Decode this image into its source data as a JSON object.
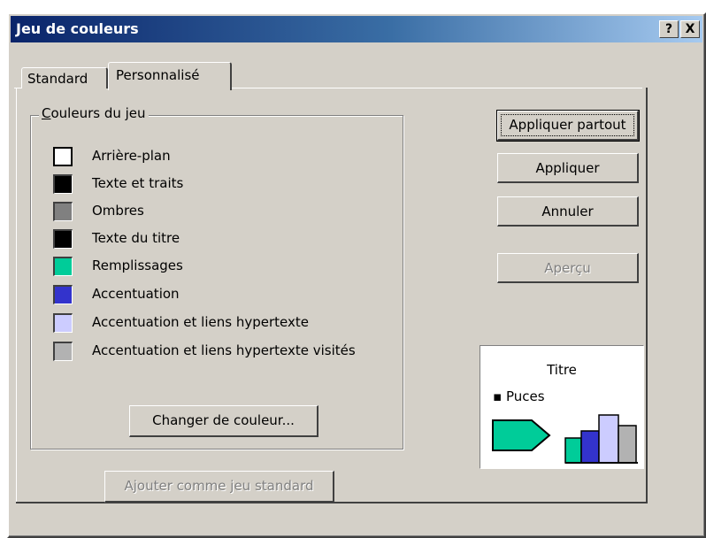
{
  "dialog": {
    "title": "Jeu de couleurs",
    "help_label": "?",
    "close_label": "X"
  },
  "tabs": [
    {
      "label": "Standard",
      "active": false
    },
    {
      "label": "Personnalisé",
      "active": true
    }
  ],
  "group": {
    "legend": "Couleurs du jeu",
    "items": [
      {
        "label": "Arrière-plan",
        "color": "#ffffff",
        "selected": true
      },
      {
        "label": "Texte et traits",
        "color": "#000000"
      },
      {
        "label": "Ombres",
        "color": "#808080"
      },
      {
        "label": "Texte du titre",
        "color": "#000000"
      },
      {
        "label": "Remplissages",
        "color": "#00cc99"
      },
      {
        "label": "Accentuation",
        "color": "#3333cc"
      },
      {
        "label": "Accentuation et liens hypertexte",
        "color": "#ccccff"
      },
      {
        "label": "Accentuation et liens hypertexte visités",
        "color": "#b2b2b2"
      }
    ],
    "change_color_button": "Changer de couleur..."
  },
  "buttons": {
    "apply_all": "Appliquer partout",
    "apply": "Appliquer",
    "cancel": "Annuler",
    "preview": "Aperçu",
    "add_standard": "Ajouter comme jeu standard"
  },
  "preview_pane": {
    "title": "Titre",
    "bullet": "Puces",
    "bar_colors": [
      "#00cc99",
      "#3333cc",
      "#ccccff",
      "#b2b2b2"
    ]
  }
}
